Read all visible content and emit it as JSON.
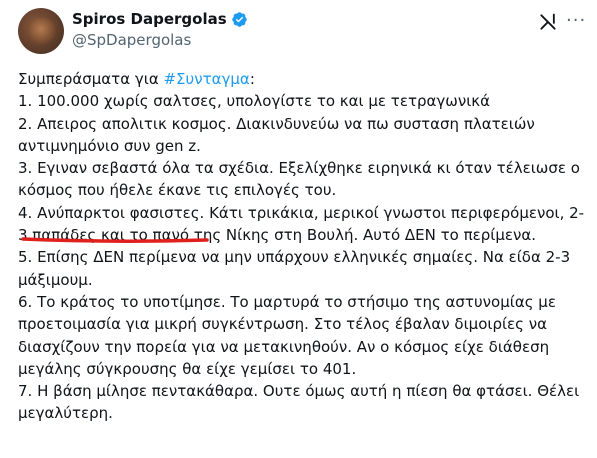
{
  "author": {
    "display_name": "Spiros Dapergolas",
    "handle": "@SpDapergolas"
  },
  "icons": {
    "verified": "verified-badge-icon",
    "grok": "grok-icon",
    "more": "more-options-icon"
  },
  "colors": {
    "hashtag": "#1d9bf0",
    "verified": "#1d9bf0",
    "annotation": "#e0201c"
  },
  "tweet": {
    "intro_prefix": "Συμπεράσματα για ",
    "hashtag": "#Συνταγμα",
    "intro_suffix": ":",
    "line1": "1. 100.000 χωρίς σαλτσες, υπολογίστε το και με τετραγωνικά",
    "line2": "2. Απειρος απολιτικ κοσμος. Διακινδυνεύω να πω συσταση πλατειών αντιμνημόνιο συν gen z.",
    "line3": "3. Εγιναν σεβαστά όλα τα σχέδια. Εξελίχθηκε ειρηνικά κι όταν τέλειωσε ο κόσμος που ήθελε έκανε τις επιλογές του.",
    "line4_underlined": "4. Ανύπαρκτοι φασιστες.",
    "line4_rest": " Κάτι τρικάκια, μερικοί γνωστοι περιφερόμενοι, 2-3 παπάδες και το πανό της Νίκης στη Βουλή. Αυτό ΔΕΝ το περίμενα.",
    "line5": "5. Επίσης ΔΕΝ περίμενα να μην υπάρχουν ελληνικές σημαίες. Να είδα 2-3 μάξιμουμ.",
    "line6": "6. Το κράτος το υποτίμησε. Το μαρτυρά το στήσιμο της αστυνομίας με προετοιμασία για μικρή συγκέντρωση. Στο τέλος έβαλαν διμοιρίες να διασχίζουν την πορεία για να μετακινηθούν. Αν ο κόσμος είχε διάθεση μεγάλης σύγκρουσης θα είχε γεμίσει το 401.",
    "line7": "7. Η βάση μίλησε πεντακάθαρα. Ουτε όμως αυτή η πίεση θα φτάσει. Θέλει μεγαλύτερη."
  }
}
